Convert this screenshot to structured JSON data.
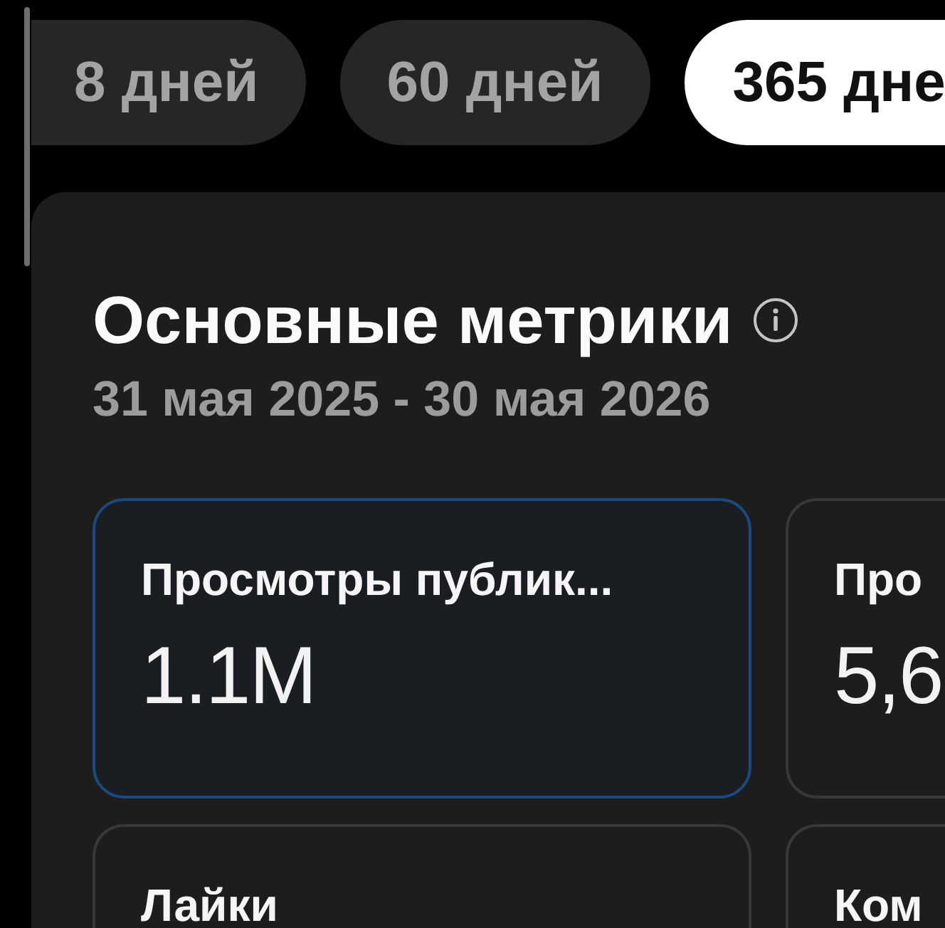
{
  "tabs": [
    {
      "label": "8 дней",
      "selected": false
    },
    {
      "label": "60 дней",
      "selected": false
    },
    {
      "label": "365 дне",
      "selected": true
    }
  ],
  "metrics_panel": {
    "title": "Основные метрики",
    "date_range": "31 мая 2025 - 30 мая 2026",
    "metrics": [
      {
        "label": "Просмотры публик...",
        "value": "1.1M",
        "selected": true
      },
      {
        "label": "Про",
        "value": "5,6",
        "selected": false
      },
      {
        "label": "Лайки",
        "selected": false
      },
      {
        "label": "Ком",
        "selected": false
      }
    ]
  }
}
